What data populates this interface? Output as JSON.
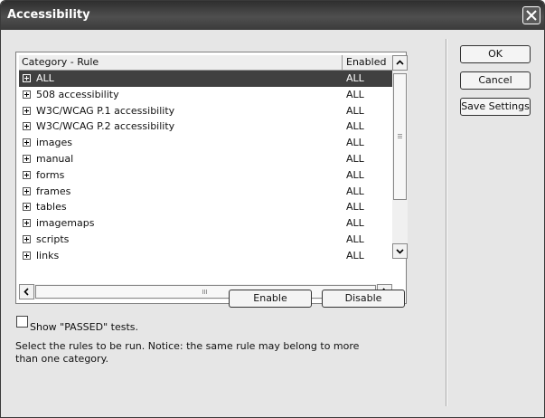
{
  "window": {
    "title": "Accessibility"
  },
  "list": {
    "columns": [
      "Category - Rule",
      "Enabled"
    ],
    "rows": [
      {
        "label": "ALL",
        "enabled": "ALL",
        "selected": true
      },
      {
        "label": "508 accessibility",
        "enabled": "ALL"
      },
      {
        "label": "W3C/WCAG P.1 accessibility",
        "enabled": "ALL"
      },
      {
        "label": "W3C/WCAG P.2 accessibility",
        "enabled": "ALL"
      },
      {
        "label": "images",
        "enabled": "ALL"
      },
      {
        "label": "manual",
        "enabled": "ALL"
      },
      {
        "label": "forms",
        "enabled": "ALL"
      },
      {
        "label": "frames",
        "enabled": "ALL"
      },
      {
        "label": "tables",
        "enabled": "ALL"
      },
      {
        "label": "imagemaps",
        "enabled": "ALL"
      },
      {
        "label": "scripts",
        "enabled": "ALL"
      },
      {
        "label": "links",
        "enabled": "ALL"
      }
    ]
  },
  "buttons": {
    "ok": "OK",
    "cancel": "Cancel",
    "save_settings": "Save Settings",
    "enable": "Enable",
    "disable": "Disable"
  },
  "options": {
    "show_passed_label": "Show \"PASSED\" tests.",
    "show_passed_checked": false
  },
  "notice": "Select the rules to be run. Notice: the same rule may belong to more than one category.",
  "icons": {
    "close": "close-icon",
    "expand": "plus-box-icon"
  }
}
